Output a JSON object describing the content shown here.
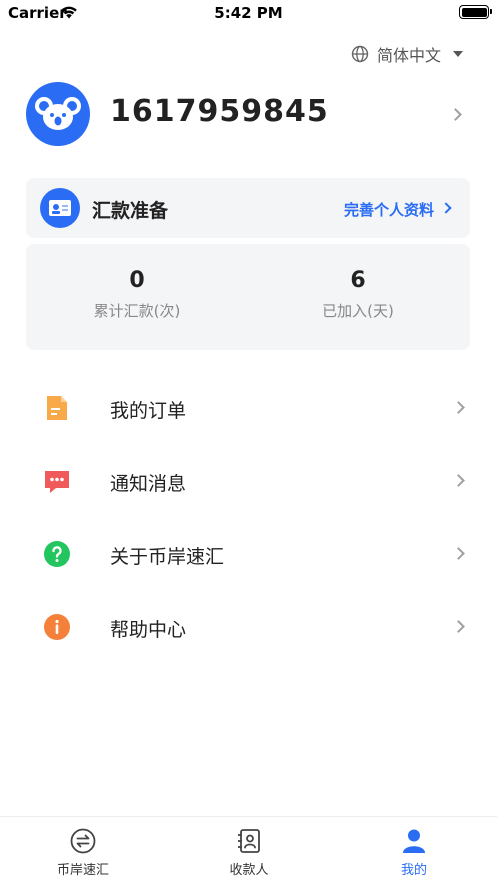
{
  "status_bar": {
    "carrier": "Carrier",
    "time": "5:42 PM"
  },
  "language": {
    "label": "简体中文",
    "icon": "globe-icon"
  },
  "profile": {
    "user_id": "1617959845",
    "avatar_icon": "koala-avatar-icon"
  },
  "prep_card": {
    "title": "汇款准备",
    "link": "完善个人资料"
  },
  "stats": [
    {
      "value": "0",
      "label": "累计汇款(次)"
    },
    {
      "value": "6",
      "label": "已加入(天)"
    }
  ],
  "menu": [
    {
      "label": "我的订单",
      "icon": "order-document-icon",
      "color": "#f8a94a"
    },
    {
      "label": "通知消息",
      "icon": "message-icon",
      "color": "#f05a5a"
    },
    {
      "label": "关于币岸速汇",
      "icon": "question-icon",
      "color": "#22c55e"
    },
    {
      "label": "帮助中心",
      "icon": "info-icon",
      "color": "#f5803a"
    }
  ],
  "tabs": [
    {
      "label": "币岸速汇",
      "icon": "exchange-icon",
      "active": false
    },
    {
      "label": "收款人",
      "icon": "contacts-icon",
      "active": false
    },
    {
      "label": "我的",
      "icon": "person-icon",
      "active": true
    }
  ],
  "colors": {
    "accent": "#2a6df4",
    "card_bg": "#f4f5f7"
  }
}
